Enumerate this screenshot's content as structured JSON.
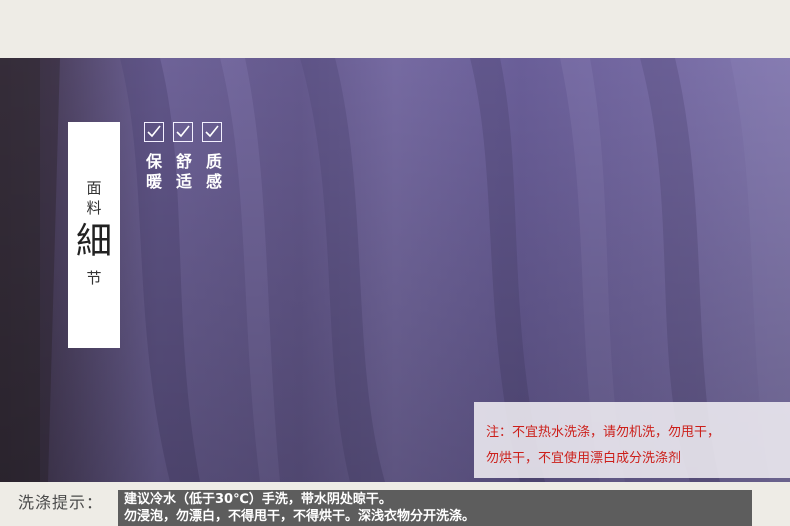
{
  "side_card": {
    "line1": "面",
    "line2": "料",
    "big": "細",
    "line3": "节"
  },
  "checks": [
    "✓",
    "✓",
    "✓"
  ],
  "features": [
    {
      "top": "保",
      "bottom": "暖"
    },
    {
      "top": "舒",
      "bottom": "适"
    },
    {
      "top": "质",
      "bottom": "感"
    }
  ],
  "notice": {
    "line1": "注：不宜热水洗涤，请勿机洗，勿甩干，",
    "line2": "勿烘干，不宜使用漂白成分洗涤剂"
  },
  "wash_tips": {
    "label": "洗涤提示：",
    "line1": "建议冷水（低于30℃）手洗，带水阴处晾干。",
    "line2": "勿浸泡，勿漂白，不得甩干，不得烘干。深浅衣物分开洗涤。"
  },
  "colors": {
    "fabric": "#6b5f8f",
    "notice_text": "#cc1f1a",
    "wash_box": "#5d5d5d"
  }
}
